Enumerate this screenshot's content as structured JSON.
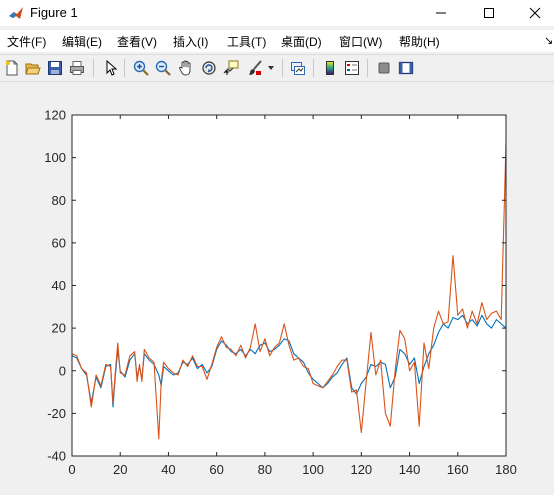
{
  "window": {
    "title": "Figure 1",
    "icons": {
      "app": "matlab-logo-icon",
      "minimize": "minimize-icon",
      "maximize": "maximize-icon",
      "close": "close-icon"
    }
  },
  "menu": [
    {
      "label": "文件(F)"
    },
    {
      "label": "编辑(E)"
    },
    {
      "label": "查看(V)"
    },
    {
      "label": "插入(I)"
    },
    {
      "label": "工具(T)"
    },
    {
      "label": "桌面(D)"
    },
    {
      "label": "窗口(W)"
    },
    {
      "label": "帮助(H)"
    }
  ],
  "menu_overflow_glyph": "↘",
  "toolbar": [
    "new-figure-icon",
    "open-file-icon",
    "save-icon",
    "print-icon",
    "pointer-icon",
    "zoom-in-icon",
    "zoom-out-icon",
    "pan-hand-icon",
    "rotate-3d-icon",
    "data-cursor-icon",
    "brush-icon",
    "brush-dropdown-icon",
    "link-plot-icon",
    "colorbar-icon",
    "legend-icon",
    "hide-plot-tools-icon",
    "show-plot-tools-icon"
  ],
  "colors": {
    "series1": "#0072bd",
    "series2": "#d95319",
    "axes": "#262626",
    "window_bg": "#f0f0f0"
  },
  "chart_data": {
    "type": "line",
    "title": "",
    "xlabel": "",
    "ylabel": "",
    "xlim": [
      0,
      180
    ],
    "ylim": [
      -40,
      120
    ],
    "xticks": [
      "0",
      "20",
      "40",
      "60",
      "80",
      "100",
      "120",
      "140",
      "160",
      "180"
    ],
    "yticks": [
      "-40",
      "-20",
      "0",
      "20",
      "40",
      "60",
      "80",
      "100",
      "120"
    ],
    "grid": false,
    "legend": null,
    "series": [
      {
        "color": "#0072bd",
        "points": [
          [
            0,
            7
          ],
          [
            2,
            6
          ],
          [
            4,
            1
          ],
          [
            6,
            -2
          ],
          [
            8,
            -15
          ],
          [
            10,
            -3
          ],
          [
            12,
            -8
          ],
          [
            14,
            2
          ],
          [
            16,
            3
          ],
          [
            17,
            -17
          ],
          [
            18,
            -2
          ],
          [
            19,
            10
          ],
          [
            20,
            0
          ],
          [
            22,
            -3
          ],
          [
            24,
            5
          ],
          [
            26,
            8
          ],
          [
            27,
            -3
          ],
          [
            28,
            2
          ],
          [
            29,
            -4
          ],
          [
            30,
            8
          ],
          [
            32,
            5
          ],
          [
            34,
            3
          ],
          [
            36,
            -2
          ],
          [
            37,
            -7
          ],
          [
            38,
            2
          ],
          [
            40,
            0
          ],
          [
            42,
            -2
          ],
          [
            44,
            -1
          ],
          [
            46,
            4
          ],
          [
            48,
            3
          ],
          [
            50,
            6
          ],
          [
            52,
            1
          ],
          [
            54,
            3
          ],
          [
            56,
            -1
          ],
          [
            58,
            2
          ],
          [
            60,
            10
          ],
          [
            62,
            14
          ],
          [
            64,
            12
          ],
          [
            66,
            9
          ],
          [
            68,
            8
          ],
          [
            70,
            10
          ],
          [
            72,
            7
          ],
          [
            74,
            10
          ],
          [
            76,
            8
          ],
          [
            78,
            12
          ],
          [
            80,
            13
          ],
          [
            82,
            9
          ],
          [
            84,
            10
          ],
          [
            86,
            12
          ],
          [
            88,
            15
          ],
          [
            90,
            14
          ],
          [
            92,
            8
          ],
          [
            94,
            6
          ],
          [
            96,
            4
          ],
          [
            98,
            -1
          ],
          [
            100,
            -4
          ],
          [
            102,
            -6
          ],
          [
            104,
            -8
          ],
          [
            106,
            -6
          ],
          [
            108,
            -3
          ],
          [
            110,
            -1
          ],
          [
            112,
            3
          ],
          [
            114,
            6
          ],
          [
            116,
            -8
          ],
          [
            118,
            -11
          ],
          [
            120,
            -6
          ],
          [
            122,
            -3
          ],
          [
            124,
            3
          ],
          [
            126,
            2
          ],
          [
            128,
            4
          ],
          [
            130,
            3
          ],
          [
            132,
            -8
          ],
          [
            134,
            -3
          ],
          [
            136,
            10
          ],
          [
            138,
            8
          ],
          [
            140,
            3
          ],
          [
            142,
            6
          ],
          [
            144,
            -6
          ],
          [
            146,
            2
          ],
          [
            148,
            8
          ],
          [
            150,
            12
          ],
          [
            152,
            18
          ],
          [
            154,
            22
          ],
          [
            156,
            20
          ],
          [
            158,
            25
          ],
          [
            160,
            24
          ],
          [
            162,
            26
          ],
          [
            164,
            22
          ],
          [
            166,
            24
          ],
          [
            168,
            21
          ],
          [
            170,
            26
          ],
          [
            172,
            22
          ],
          [
            174,
            20
          ],
          [
            176,
            24
          ],
          [
            178,
            22
          ],
          [
            180,
            20
          ]
        ]
      },
      {
        "color": "#d95319",
        "points": [
          [
            0,
            8
          ],
          [
            2,
            7
          ],
          [
            4,
            1
          ],
          [
            6,
            -1
          ],
          [
            8,
            -17
          ],
          [
            10,
            -2
          ],
          [
            12,
            -7
          ],
          [
            14,
            3
          ],
          [
            16,
            2
          ],
          [
            17,
            -15
          ],
          [
            18,
            0
          ],
          [
            19,
            13
          ],
          [
            20,
            -1
          ],
          [
            22,
            -2
          ],
          [
            24,
            7
          ],
          [
            26,
            9
          ],
          [
            27,
            -5
          ],
          [
            28,
            3
          ],
          [
            29,
            -5
          ],
          [
            30,
            10
          ],
          [
            32,
            6
          ],
          [
            34,
            4
          ],
          [
            36,
            -32
          ],
          [
            37,
            -5
          ],
          [
            38,
            4
          ],
          [
            40,
            1
          ],
          [
            42,
            -1
          ],
          [
            44,
            -2
          ],
          [
            46,
            5
          ],
          [
            48,
            2
          ],
          [
            50,
            7
          ],
          [
            52,
            2
          ],
          [
            54,
            2
          ],
          [
            56,
            -4
          ],
          [
            58,
            3
          ],
          [
            60,
            11
          ],
          [
            62,
            16
          ],
          [
            64,
            11
          ],
          [
            66,
            10
          ],
          [
            68,
            7
          ],
          [
            70,
            12
          ],
          [
            72,
            6
          ],
          [
            74,
            11
          ],
          [
            76,
            22
          ],
          [
            78,
            9
          ],
          [
            80,
            15
          ],
          [
            82,
            7
          ],
          [
            84,
            11
          ],
          [
            86,
            13
          ],
          [
            88,
            22
          ],
          [
            90,
            12
          ],
          [
            92,
            5
          ],
          [
            94,
            6
          ],
          [
            96,
            2
          ],
          [
            98,
            1
          ],
          [
            100,
            -6
          ],
          [
            102,
            -7
          ],
          [
            104,
            -8
          ],
          [
            106,
            -5
          ],
          [
            108,
            -2
          ],
          [
            110,
            2
          ],
          [
            112,
            5
          ],
          [
            114,
            5
          ],
          [
            116,
            -10
          ],
          [
            118,
            -9
          ],
          [
            120,
            -29
          ],
          [
            122,
            -5
          ],
          [
            124,
            18
          ],
          [
            126,
            -2
          ],
          [
            128,
            5
          ],
          [
            130,
            -20
          ],
          [
            132,
            -26
          ],
          [
            134,
            0
          ],
          [
            136,
            19
          ],
          [
            138,
            15
          ],
          [
            140,
            0
          ],
          [
            142,
            4
          ],
          [
            144,
            -26
          ],
          [
            146,
            13
          ],
          [
            148,
            1
          ],
          [
            150,
            20
          ],
          [
            152,
            28
          ],
          [
            154,
            22
          ],
          [
            156,
            23
          ],
          [
            158,
            54
          ],
          [
            160,
            26
          ],
          [
            162,
            29
          ],
          [
            164,
            20
          ],
          [
            166,
            28
          ],
          [
            168,
            22
          ],
          [
            170,
            32
          ],
          [
            172,
            24
          ],
          [
            174,
            27
          ],
          [
            176,
            28
          ],
          [
            178,
            24
          ],
          [
            180,
            107
          ]
        ]
      }
    ]
  }
}
